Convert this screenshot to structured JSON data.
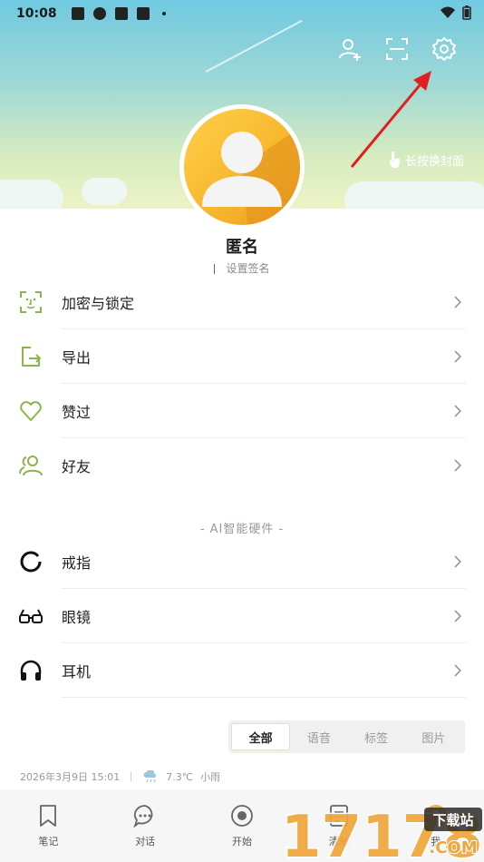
{
  "status_bar": {
    "time": "10:08"
  },
  "cover": {
    "hint": "长按换封面"
  },
  "profile": {
    "username": "匿名",
    "signature_placeholder": "设置签名"
  },
  "menu": [
    {
      "label": "加密与锁定",
      "icon": "face-lock-icon"
    },
    {
      "label": "导出",
      "icon": "export-icon"
    },
    {
      "label": "赞过",
      "icon": "heart-icon"
    },
    {
      "label": "好友",
      "icon": "friends-icon"
    }
  ],
  "section": {
    "title": "- AI智能硬件 -"
  },
  "hardware": [
    {
      "label": "戒指",
      "icon": "ring-icon"
    },
    {
      "label": "眼镜",
      "icon": "glasses-icon"
    },
    {
      "label": "耳机",
      "icon": "headphones-icon"
    }
  ],
  "tabs": [
    "全部",
    "语音",
    "标签",
    "图片"
  ],
  "entry": {
    "date": "2026年3月9日 15:01",
    "temperature": "7.3℃",
    "weather": "小雨"
  },
  "bottom_nav": [
    "笔记",
    "对话",
    "开始",
    "清单",
    "我"
  ],
  "watermark": {
    "text": "17178",
    "badge": "下载站",
    "domain": ".COM"
  },
  "colors": {
    "accent": "#8cb44a",
    "arrow": "#e02020",
    "avatar": "#f6b52c"
  }
}
